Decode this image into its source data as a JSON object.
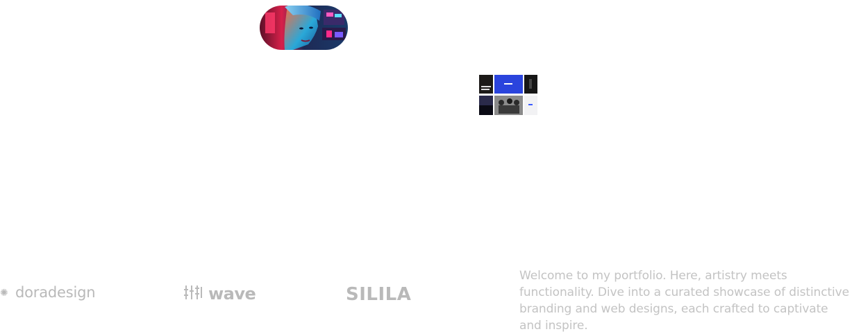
{
  "hero": {
    "image": "portrait-neon-photo"
  },
  "work_preview": {
    "image": "portfolio-thumbnail-grid"
  },
  "logos": {
    "dora": "doradesign",
    "wave": "wave",
    "silila": "SILILA",
    "color": "#b9b9b9"
  },
  "intro": {
    "text": "Welcome to my portfolio. Here, artistry meets functionality. Dive into a curated showcase of distinctive branding and web designs, each crafted to captivate and inspire."
  },
  "colors": {
    "intro_text": "#c3c3c3",
    "background": "#ffffff"
  }
}
